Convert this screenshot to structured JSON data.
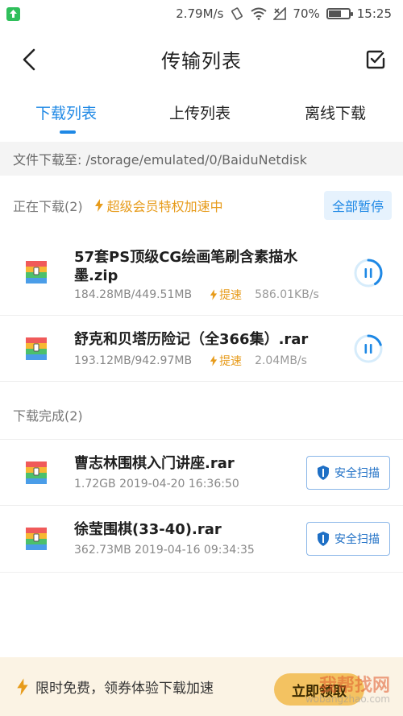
{
  "status_bar": {
    "speed": "2.79M/s",
    "battery": "70%",
    "battery_level": 0.7,
    "time": "15:25",
    "icons": [
      "upload-notification-icon",
      "vibrate-icon",
      "wifi-icon",
      "signal-icon",
      "battery-icon"
    ]
  },
  "header": {
    "title": "传输列表"
  },
  "tabs": [
    {
      "label": "下载列表",
      "active": true
    },
    {
      "label": "上传列表",
      "active": false
    },
    {
      "label": "离线下载",
      "active": false
    }
  ],
  "path_bar": {
    "text": "文件下载至: /storage/emulated/0/BaiduNetdisk"
  },
  "downloading": {
    "label": "正在下载(2)",
    "vip_text": "超级会员特权加速中",
    "pause_all": "全部暂停",
    "items": [
      {
        "name_line1": "57套PS顶级CG绘画笔刷含素描水",
        "name_line2": "墨.zip",
        "size": "184.28MB/449.51MB",
        "speedup": "提速",
        "speed": "586.01KB/s",
        "progress": 0.41
      },
      {
        "name_line1": "舒克和贝塔历险记（全366集）.rar",
        "size": "193.12MB/942.97MB",
        "speedup": "提速",
        "speed": "2.04MB/s",
        "progress": 0.2
      }
    ]
  },
  "completed": {
    "label": "下载完成(2)",
    "items": [
      {
        "name": "曹志林围棋入门讲座.rar",
        "meta": "1.72GB 2019-04-20 16:36:50",
        "scan": "安全扫描"
      },
      {
        "name": "徐莹围棋(33-40).rar",
        "meta": "362.73MB 2019-04-16 09:34:35",
        "scan": "安全扫描"
      }
    ]
  },
  "promo": {
    "text": "限时免费，领券体验下载加速",
    "button": "立即领取"
  },
  "watermark": {
    "title": "我帮找网",
    "sub": "wobangzhao.com"
  },
  "colors": {
    "accent": "#1e88e5",
    "vip": "#e79b1a",
    "promo_bg": "#fbf3e4"
  }
}
